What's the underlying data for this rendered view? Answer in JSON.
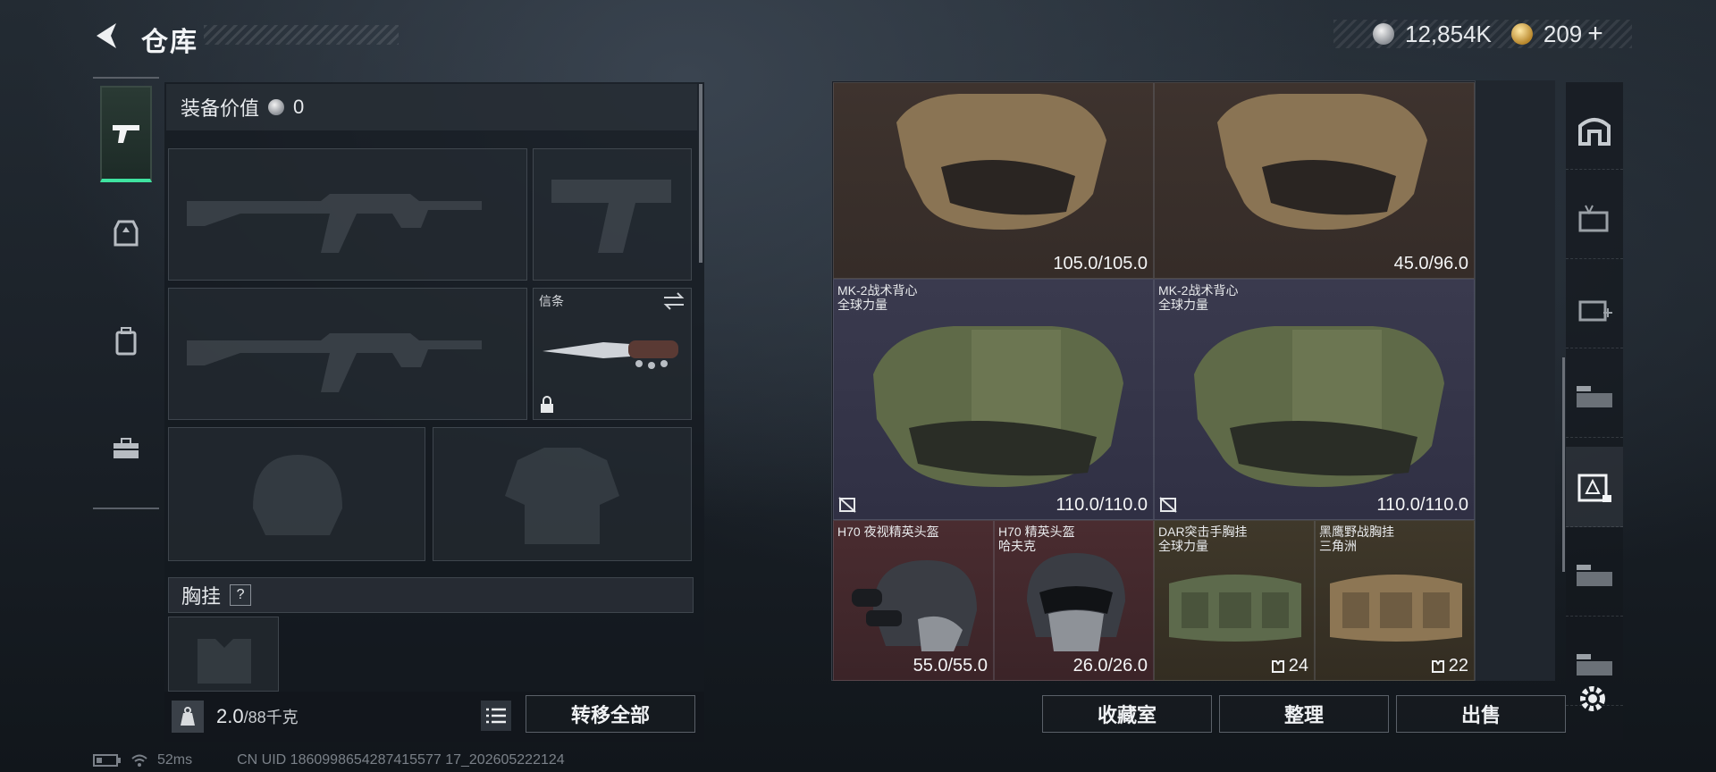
{
  "header": {
    "title": "仓库"
  },
  "currency": {
    "silver": "12,854K",
    "gold": "209",
    "plus": "+"
  },
  "loadout": {
    "equip_value_label": "装备价值",
    "equip_value": "0",
    "melee_label": "信条",
    "chest_rig_label": "胸挂",
    "help": "?"
  },
  "weight": {
    "current": "2.0",
    "max": "/88千克"
  },
  "buttons": {
    "transfer_all": "转移全部",
    "collection": "收藏室",
    "organize": "整理",
    "sell": "出售"
  },
  "storage": {
    "items": [
      {
        "name": "",
        "sub": "",
        "value": "105.0/105.0",
        "color": "brown"
      },
      {
        "name": "",
        "sub": "",
        "value": "45.0/96.0",
        "color": "brown"
      },
      {
        "name": "MK-2战术背心",
        "sub": "全球力量",
        "value": "110.0/110.0",
        "color": "purple"
      },
      {
        "name": "MK-2战术背心",
        "sub": "全球力量",
        "value": "110.0/110.0",
        "color": "purple"
      },
      {
        "name": "H70 夜视精英头盔",
        "sub": "",
        "value": "55.0/55.0",
        "color": "red"
      },
      {
        "name": "H70 精英头盔",
        "sub": "哈夫克",
        "value": "26.0/26.0",
        "color": "red"
      },
      {
        "name": "DAR突击手胸挂",
        "sub": "全球力量",
        "value": "24",
        "color": "amber"
      },
      {
        "name": "黑鹰野战胸挂",
        "sub": "三角洲",
        "value": "22",
        "color": "amber"
      }
    ]
  },
  "status": {
    "ping": "52ms",
    "uid": "CN UID 1860998654287415577 17_202605222124"
  },
  "colors": {
    "accent": "#3fe3a0",
    "brown": "#3e332e",
    "purple": "#3a3a4e",
    "red": "#4a2c30",
    "amber": "#3f382a"
  },
  "icons": [
    "back-arrow-icon",
    "silver-coin-icon",
    "gold-coin-icon",
    "pistol-icon",
    "armor-icon",
    "backpack-icon",
    "toolbox-icon",
    "kg-icon",
    "list-icon",
    "gear-icon",
    "swap-icon",
    "lock-icon",
    "no-repair-icon",
    "rig-icon"
  ]
}
